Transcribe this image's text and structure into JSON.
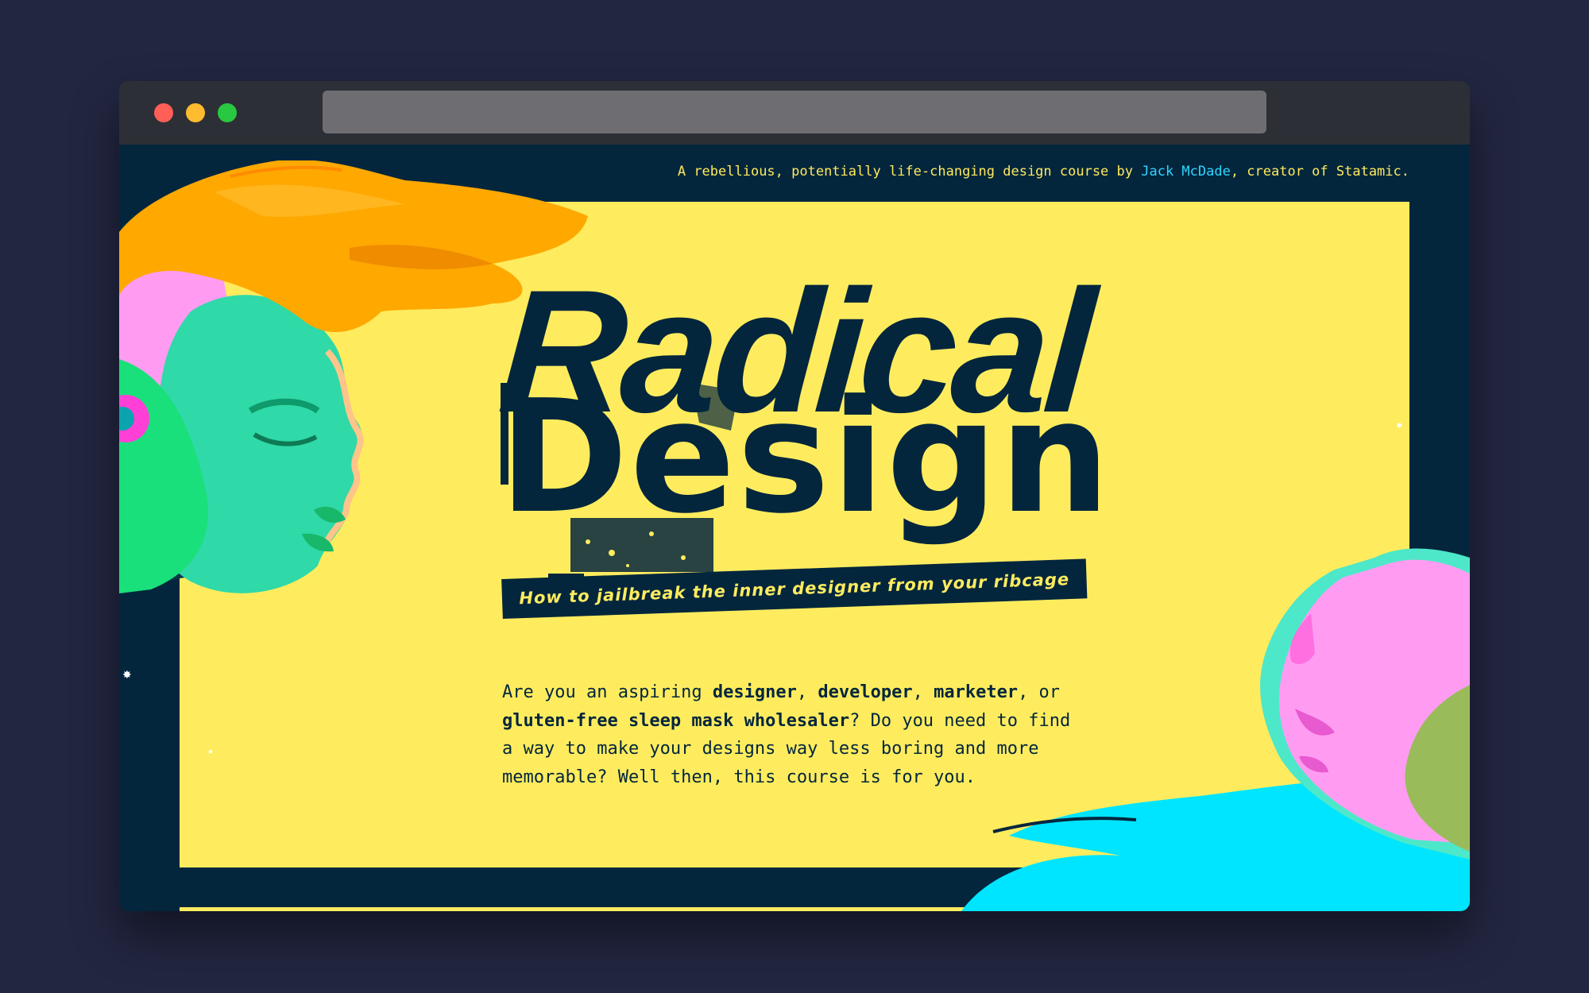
{
  "byline": {
    "prefix": "A rebellious, potentially life-changing design course by ",
    "author": "Jack McDade",
    "suffix": ", creator of Statamic."
  },
  "hero": {
    "title_line1": "Radical",
    "title_line2": "Design",
    "tagline": "How to jailbreak the inner designer from your ribcage"
  },
  "intro": {
    "t1": "Are you an aspiring ",
    "b1": "designer",
    "t2": ", ",
    "b2": "developer",
    "t3": ", ",
    "b3": "marketer",
    "t4": ", or ",
    "b4": "gluten-free sleep mask wholesaler",
    "t5": "? Do you need to find a way to make your designs way less boring and more memorable? Well then, this course is for you."
  },
  "colors": {
    "background": "#222640",
    "page_navy": "#03263d",
    "panel_yellow": "#ffec5e",
    "link_cyan": "#2fd6ff",
    "hair_orange": "#ffa800",
    "face_green": "#2fd9a8",
    "pink": "#ff9cf2",
    "cyan_wave": "#00e5ff"
  },
  "icons": [
    "window-close-dot",
    "window-minimize-dot",
    "window-zoom-dot",
    "star-icon"
  ]
}
